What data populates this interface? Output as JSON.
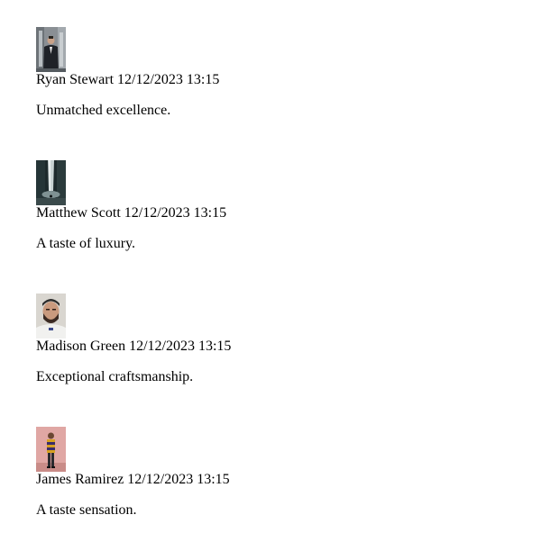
{
  "comments": [
    {
      "author": "Ryan Stewart",
      "date": "12/12/2023 13:15",
      "text": "Unmatched excellence.",
      "avatar": "man-in-suit-city-photo"
    },
    {
      "author": "Matthew Scott",
      "date": "12/12/2023 13:15",
      "text": "A taste of luxury.",
      "avatar": "waterfall-photo"
    },
    {
      "author": "Madison Green",
      "date": "12/12/2023 13:15",
      "text": "Exceptional craftsmanship.",
      "avatar": "man-with-beard-photo"
    },
    {
      "author": "James Ramirez",
      "date": "12/12/2023 13:15",
      "text": "A taste sensation.",
      "avatar": "man-pink-wall-photo"
    }
  ]
}
